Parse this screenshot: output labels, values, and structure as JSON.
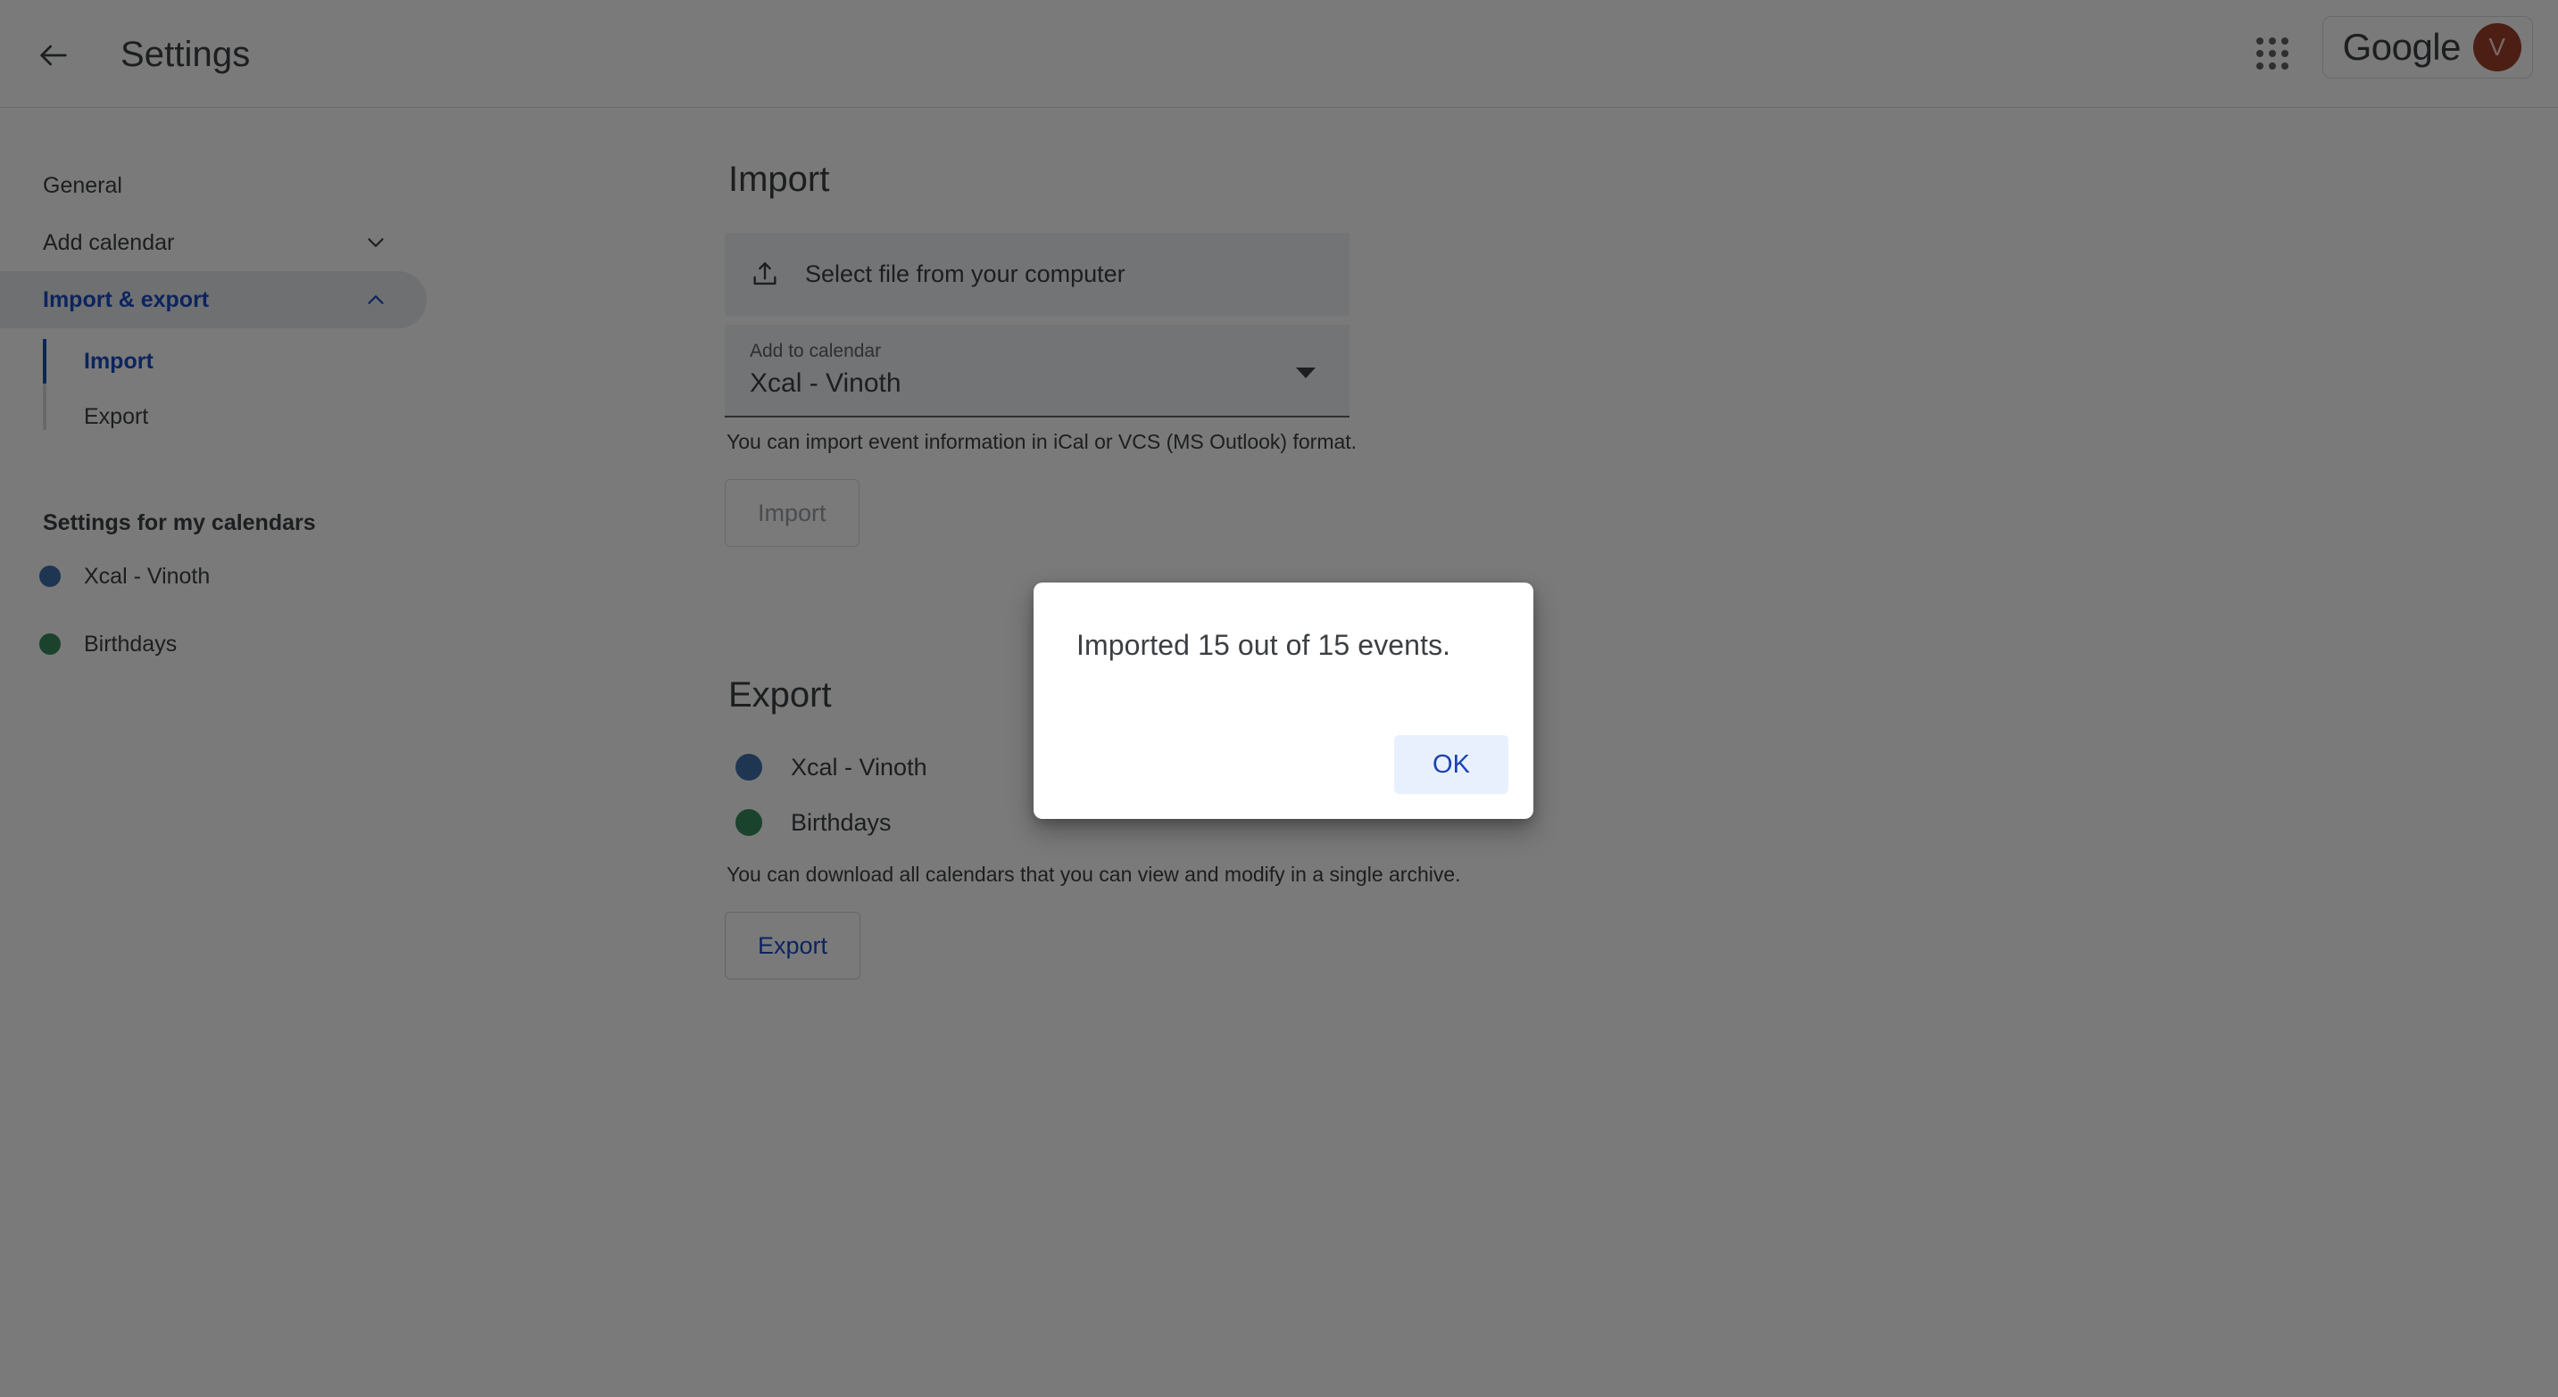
{
  "header": {
    "back_icon": "back-arrow-icon",
    "title": "Settings",
    "apps_icon": "apps-grid-icon",
    "brand": "Google",
    "avatar_initial": "V"
  },
  "sidebar": {
    "items": [
      {
        "label": "General",
        "icon": "",
        "active": false
      },
      {
        "label": "Add calendar",
        "icon": "chevron-down-icon",
        "active": false
      },
      {
        "label": "Import & export",
        "icon": "chevron-up-icon",
        "active": true
      }
    ],
    "subitems": [
      {
        "label": "Import",
        "active": true
      },
      {
        "label": "Export",
        "active": false
      }
    ],
    "calendars_title": "Settings for my calendars",
    "calendars": [
      {
        "label": "Xcal - Vinoth",
        "color": "#3f72ab"
      },
      {
        "label": "Birthdays",
        "color": "#3a8a5e"
      }
    ]
  },
  "main": {
    "import": {
      "heading": "Import",
      "file_picker_label": "Select file from your computer",
      "file_picker_icon": "upload-icon",
      "select_label": "Add to calendar",
      "select_value": "Xcal - Vinoth",
      "hint": "You can import event information in iCal or VCS (MS Outlook) format.",
      "button_label": "Import"
    },
    "export": {
      "heading": "Export",
      "calendars": [
        {
          "label": "Xcal - Vinoth",
          "color": "#3f72ab"
        },
        {
          "label": "Birthdays",
          "color": "#3a8a5e"
        }
      ],
      "hint": "You can download all calendars that you can view and modify in a single archive.",
      "button_label": "Export"
    }
  },
  "dialog": {
    "message": "Imported 15 out of 15 events.",
    "ok_label": "OK"
  },
  "colors": {
    "accent_blue": "#1a4bc4",
    "dialog_button_bg": "#e8f0fe",
    "active_nav_bg": "#e8eaed",
    "avatar_bg": "#a0402a"
  }
}
